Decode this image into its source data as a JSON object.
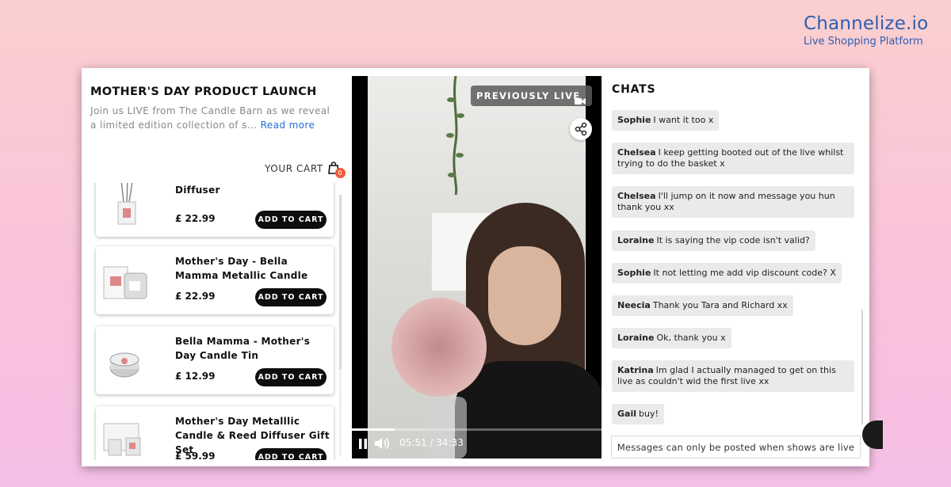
{
  "brand": {
    "name": "Channelize.io",
    "tagline": "Live Shopping Platform"
  },
  "show": {
    "title": "MOTHER'S DAY PRODUCT LAUNCH",
    "description": "Join us LIVE from The Candle Barn as we reveal a limited edition collection of s...",
    "read_more": "Read more"
  },
  "cart": {
    "label": "YOUR CART",
    "count": "0"
  },
  "products": [
    {
      "name": "Diffuser",
      "price": "£ 22.99",
      "button": "ADD TO CART"
    },
    {
      "name": "Mother's Day - Bella Mamma Metallic Candle",
      "price": "£ 22.99",
      "button": "ADD TO CART"
    },
    {
      "name": "Bella Mamma - Mother's Day Candle Tin",
      "price": "£ 12.99",
      "button": "ADD TO CART"
    },
    {
      "name": "Mother's Day Metalllic Candle & Reed Diffuser Gift Set",
      "price": "£ 59.99",
      "button": "ADD TO CART"
    }
  ],
  "video": {
    "badge": "PREVIOUSLY LIVE",
    "current_time": "05:51",
    "separator": "/",
    "duration": "34:33",
    "progress": 0.17
  },
  "chat": {
    "title": "CHATS",
    "messages": [
      {
        "user": "Sophie",
        "text": "I want it too x"
      },
      {
        "user": "Chelsea",
        "text": "I keep getting booted out of the live whilst trying to do the basket x"
      },
      {
        "user": "Chelsea",
        "text": "I'll jump on it now and message you hun thank you xx"
      },
      {
        "user": "Loraine",
        "text": "It is saying the vip code isn't valid?"
      },
      {
        "user": "Sophie",
        "text": "It not letting me add vip discount code? X"
      },
      {
        "user": "Neecia",
        "text": "Thank you Tara and Richard xx"
      },
      {
        "user": "Loraine",
        "text": "Ok, thank you x"
      },
      {
        "user": "Katrina",
        "text": "Im glad I actually managed to get on this live as couldn't wid the first live xx"
      },
      {
        "user": "Gail",
        "text": "buy!"
      }
    ],
    "input_notice": "Messages can only be posted when shows are live"
  },
  "colors": {
    "accent": "#2d5fb0",
    "link": "#1f6fd6",
    "button": "#0d0d0d",
    "badge": "#f05a3a"
  }
}
